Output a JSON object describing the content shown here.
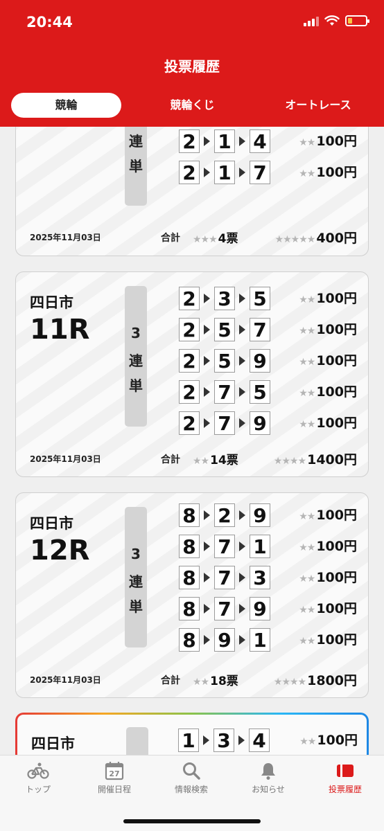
{
  "status_bar": {
    "time": "20:44",
    "battery_level": 0.25
  },
  "header": {
    "title": "投票履歴"
  },
  "tabs": [
    {
      "label": "競輪",
      "active": true
    },
    {
      "label": "競輪くじ",
      "active": false
    },
    {
      "label": "オートレース",
      "active": false
    }
  ],
  "cards": [
    {
      "venue": "",
      "race": "",
      "bet_type_chars": [
        "連",
        "単"
      ],
      "tickets": [
        {
          "numbers": [
            "2",
            "1",
            "4"
          ],
          "amount": "100円"
        },
        {
          "numbers": [
            "2",
            "1",
            "7"
          ],
          "amount": "100円"
        }
      ],
      "date": "2025年11月03日",
      "total_label": "合計",
      "total_tickets": "4票",
      "total_amount": "400円"
    },
    {
      "venue": "四日市",
      "race": "11R",
      "bet_type_chars": [
        "3",
        "連",
        "単"
      ],
      "tickets": [
        {
          "numbers": [
            "2",
            "3",
            "5"
          ],
          "amount": "100円"
        },
        {
          "numbers": [
            "2",
            "5",
            "7"
          ],
          "amount": "100円"
        },
        {
          "numbers": [
            "2",
            "5",
            "9"
          ],
          "amount": "100円"
        },
        {
          "numbers": [
            "2",
            "7",
            "5"
          ],
          "amount": "100円"
        },
        {
          "numbers": [
            "2",
            "7",
            "9"
          ],
          "amount": "100円"
        }
      ],
      "date": "2025年11月03日",
      "total_label": "合計",
      "total_tickets": "14票",
      "total_amount": "1400円"
    },
    {
      "venue": "四日市",
      "race": "12R",
      "bet_type_chars": [
        "3",
        "連",
        "単"
      ],
      "tickets": [
        {
          "numbers": [
            "8",
            "2",
            "9"
          ],
          "amount": "100円"
        },
        {
          "numbers": [
            "8",
            "7",
            "1"
          ],
          "amount": "100円"
        },
        {
          "numbers": [
            "8",
            "7",
            "3"
          ],
          "amount": "100円"
        },
        {
          "numbers": [
            "8",
            "7",
            "9"
          ],
          "amount": "100円"
        },
        {
          "numbers": [
            "8",
            "9",
            "1"
          ],
          "amount": "100円"
        }
      ],
      "date": "2025年11月03日",
      "total_label": "合計",
      "total_tickets": "18票",
      "total_amount": "1800円"
    },
    {
      "venue": "四日市",
      "race": "",
      "bet_type_chars": [],
      "tickets": [
        {
          "numbers": [
            "1",
            "3",
            "4"
          ],
          "amount": "100円"
        }
      ],
      "date": "",
      "total_label": "",
      "total_tickets": "",
      "total_amount": ""
    }
  ],
  "bottom_nav": [
    {
      "label": "トップ",
      "icon": "bicycle-icon",
      "active": false
    },
    {
      "label": "開催日程",
      "icon": "calendar-icon",
      "calendar_day": "27",
      "active": false
    },
    {
      "label": "情報検索",
      "icon": "search-icon",
      "active": false
    },
    {
      "label": "お知らせ",
      "icon": "bell-icon",
      "active": false
    },
    {
      "label": "投票履歴",
      "icon": "history-icon",
      "active": true
    }
  ],
  "colors": {
    "brand_red": "#dc1a1a",
    "inactive_gray": "#777777"
  }
}
